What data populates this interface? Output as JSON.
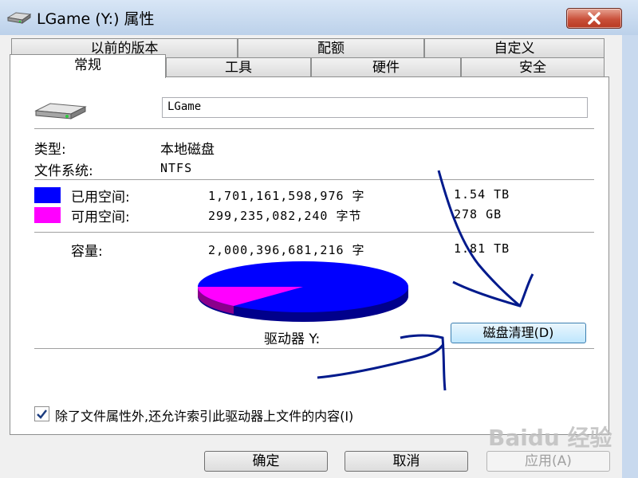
{
  "window": {
    "title": "LGame (Y:) 属性",
    "close_icon": "close-icon"
  },
  "tabs_row1": [
    {
      "label": "以前的版本"
    },
    {
      "label": "配额"
    },
    {
      "label": "自定义"
    }
  ],
  "tabs_row2": [
    {
      "label": "常规",
      "active": true
    },
    {
      "label": "工具"
    },
    {
      "label": "硬件"
    },
    {
      "label": "安全"
    }
  ],
  "general": {
    "drive_icon": "drive-icon",
    "name_value": "LGame",
    "type_label": "类型:",
    "type_value": "本地磁盘",
    "fs_label": "文件系统:",
    "fs_value": "NTFS",
    "used": {
      "label": "已用空间:",
      "bytes": "1,701,161,598,976 字",
      "size": "1.54 TB",
      "color": "#0000ff"
    },
    "free": {
      "label": "可用空间:",
      "bytes": "299,235,082,240 字节",
      "size": "278 GB",
      "color": "#ff00ff"
    },
    "capacity": {
      "label": "容量:",
      "bytes": "2,000,396,681,216 字",
      "size": "1.81 TB"
    },
    "drive_label": "驱动器 Y:",
    "cleanup_button": "磁盘清理(D)",
    "index_checkbox": {
      "checked": true,
      "label": "除了文件属性外,还允许索引此驱动器上文件的内容(I)"
    }
  },
  "buttons": {
    "ok": "确定",
    "cancel": "取消",
    "apply": "应用(A)"
  },
  "pie": {
    "used_fraction": 0.85,
    "free_fraction": 0.15
  },
  "watermark": "Baidu 经验"
}
